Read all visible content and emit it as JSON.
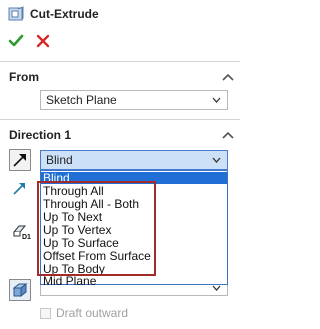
{
  "header": {
    "title": "Cut-Extrude",
    "feature_icon": "cut-extrude-icon"
  },
  "actions": {
    "ok_icon": "check-icon",
    "cancel_icon": "close-icon"
  },
  "from_section": {
    "title": "From",
    "start_value": "Sketch Plane"
  },
  "direction1": {
    "title": "Direction 1",
    "end_condition": "Blind",
    "options": [
      "Blind",
      "Through All",
      "Through All - Both",
      "Up To Next",
      "Up To Vertex",
      "Up To Surface",
      "Offset From Surface",
      "Up To Body",
      "Mid Plane"
    ],
    "selected_index": 0,
    "draft_label": "Draft outward"
  },
  "colors": {
    "ok_green": "#2e9b2e",
    "cancel_red": "#d42a2a",
    "selection_blue": "#1f6fd6",
    "highlight_red": "#a52a2a"
  }
}
